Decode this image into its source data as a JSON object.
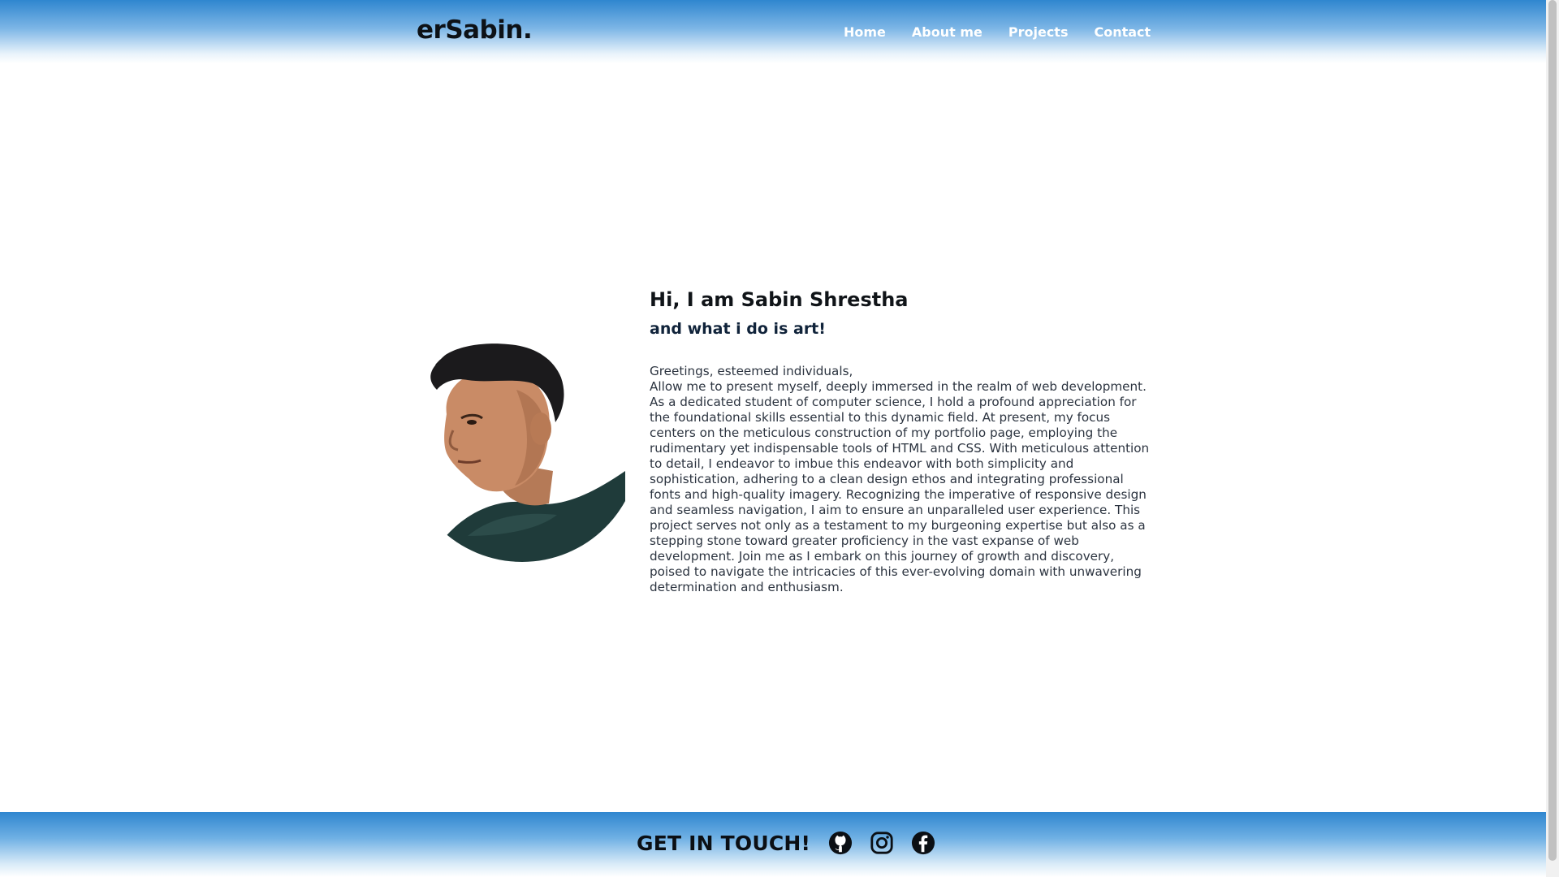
{
  "header": {
    "brand": "erSabin.",
    "nav": [
      "Home",
      "About me",
      "Projects",
      "Contact"
    ]
  },
  "hero": {
    "title": "Hi, I am Sabin Shrestha",
    "subtitle": "and what i do is art!",
    "greeting": "Greetings, esteemed individuals,",
    "bio": "Allow me to present myself, deeply immersed in the realm of web development. As a dedicated student of computer science, I hold a profound appreciation for the foundational skills essential to this dynamic field. At present, my focus centers on the meticulous construction of my portfolio page, employing the rudimentary yet indispensable tools of HTML and CSS. With meticulous attention to detail, I endeavor to imbue this endeavor with both simplicity and sophistication, adhering to a clean design ethos and integrating professional fonts and high-quality imagery. Recognizing the imperative of responsive design and seamless navigation, I aim to ensure an unparalleled user experience. This project serves not only as a testament to my burgeoning expertise but also as a stepping stone toward greater proficiency in the vast expanse of web development. Join me as I embark on this journey of growth and discovery, poised to navigate the intricacies of this ever-evolving domain with unwavering determination and enthusiasm."
  },
  "footer": {
    "cta": "GET IN TOUCH!",
    "socials": [
      "github-icon",
      "instagram-icon",
      "facebook-icon"
    ]
  },
  "colors": {
    "header_gradient_top": "#2f86cf",
    "text_dark": "#101418",
    "subtitle": "#10233a"
  }
}
